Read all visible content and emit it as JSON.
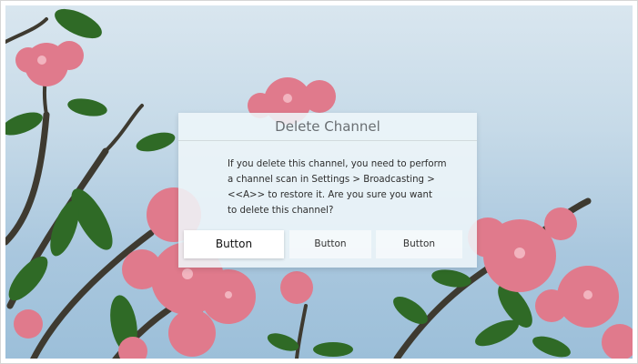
{
  "dialog": {
    "title": "Delete Channel",
    "message_lines": [
      "If you delete this channel, you need to perform",
      "a channel scan in Settings > Broadcasting >",
      "<<A>> to restore it. Are you sure you want",
      "to delete this channel?"
    ],
    "buttons": [
      "Button",
      "Button",
      "Button"
    ],
    "focused_button_index": 0
  },
  "background": {
    "sky_color": "#b7d0e3",
    "flower_color": "#e07a8c",
    "leaf_color": "#2f6a26"
  }
}
